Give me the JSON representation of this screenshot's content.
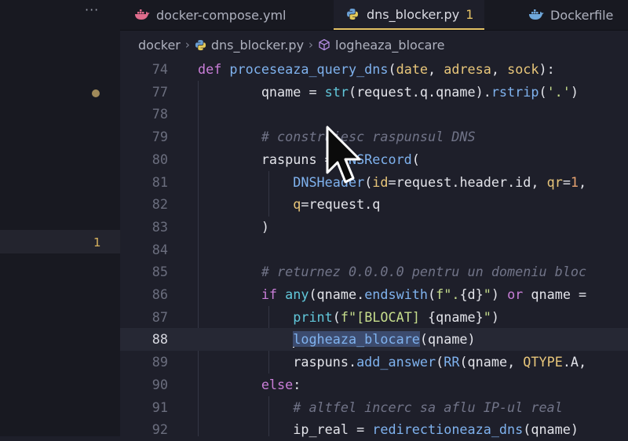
{
  "activity": {
    "more_label": "···",
    "badge_count": "1"
  },
  "tabs": [
    {
      "label": "docker-compose.yml",
      "icon": "docker-icon",
      "badge": ""
    },
    {
      "label": "dns_blocker.py",
      "icon": "python-icon",
      "badge": "1"
    },
    {
      "label": "Dockerfile",
      "icon": "docker-icon",
      "badge": ""
    }
  ],
  "breadcrumbs": [
    "docker",
    "dns_blocker.py",
    "logheaza_blocare"
  ],
  "colors": {
    "accent": "#e4c265",
    "keyword": "#c97ed8",
    "function": "#7fb2ee",
    "string": "#c6dd8c",
    "comment": "#717488"
  },
  "lines": [
    {
      "num": "74",
      "tokens": [
        {
          "t": "def ",
          "c": "kw"
        },
        {
          "t": "proceseaza_query_dns",
          "c": "fn"
        },
        {
          "t": "("
        },
        {
          "t": "date",
          "c": "pm"
        },
        {
          "t": ", "
        },
        {
          "t": "adresa",
          "c": "pm"
        },
        {
          "t": ", "
        },
        {
          "t": "sock",
          "c": "pm"
        },
        {
          "t": "):"
        }
      ]
    },
    {
      "num": "77",
      "tokens": [
        {
          "t": "        qname = "
        },
        {
          "t": "str",
          "c": "bi"
        },
        {
          "t": "(request.q.qname)."
        },
        {
          "t": "rstrip",
          "c": "fn"
        },
        {
          "t": "("
        },
        {
          "t": "'.'",
          "c": "str"
        },
        {
          "t": ")"
        }
      ]
    },
    {
      "num": "78",
      "tokens": []
    },
    {
      "num": "79",
      "tokens": [
        {
          "t": "        "
        },
        {
          "t": "# construiesc raspunsul DNS",
          "c": "cm"
        }
      ]
    },
    {
      "num": "80",
      "tokens": [
        {
          "t": "        raspuns = "
        },
        {
          "t": "DNSRecord",
          "c": "fn"
        },
        {
          "t": "("
        }
      ]
    },
    {
      "num": "81",
      "tokens": [
        {
          "t": "            "
        },
        {
          "t": "DNSHeader",
          "c": "fn"
        },
        {
          "t": "("
        },
        {
          "t": "id",
          "c": "pm"
        },
        {
          "t": "=request.header.id, "
        },
        {
          "t": "qr",
          "c": "pm"
        },
        {
          "t": "="
        },
        {
          "t": "1",
          "c": "num"
        },
        {
          "t": ","
        }
      ]
    },
    {
      "num": "82",
      "tokens": [
        {
          "t": "            "
        },
        {
          "t": "q",
          "c": "pm"
        },
        {
          "t": "=request.q"
        }
      ]
    },
    {
      "num": "83",
      "tokens": [
        {
          "t": "        )"
        }
      ]
    },
    {
      "num": "84",
      "tokens": []
    },
    {
      "num": "85",
      "tokens": [
        {
          "t": "        "
        },
        {
          "t": "# returnez 0.0.0.0 pentru un domeniu bloc",
          "c": "cm"
        }
      ]
    },
    {
      "num": "86",
      "tokens": [
        {
          "t": "        "
        },
        {
          "t": "if ",
          "c": "kw"
        },
        {
          "t": "any",
          "c": "bi"
        },
        {
          "t": "(qname."
        },
        {
          "t": "endswith",
          "c": "fn"
        },
        {
          "t": "("
        },
        {
          "t": "f\".",
          "c": "str"
        },
        {
          "t": "{d}"
        },
        {
          "t": "\"",
          "c": "str"
        },
        {
          "t": ") "
        },
        {
          "t": "or",
          "c": "kw"
        },
        {
          "t": " qname ="
        }
      ]
    },
    {
      "num": "87",
      "tokens": [
        {
          "t": "            "
        },
        {
          "t": "print",
          "c": "bi"
        },
        {
          "t": "("
        },
        {
          "t": "f\"[BLOCAT] ",
          "c": "str"
        },
        {
          "t": "{qname}"
        },
        {
          "t": "\"",
          "c": "str"
        },
        {
          "t": ")"
        }
      ]
    },
    {
      "num": "88",
      "current": true,
      "tokens": [
        {
          "t": "            "
        },
        {
          "t": "|",
          "c": "caret"
        },
        {
          "t": "logheaza_blocare",
          "c": "fn sel"
        },
        {
          "t": "(qname)"
        }
      ]
    },
    {
      "num": "89",
      "tokens": [
        {
          "t": "            raspuns."
        },
        {
          "t": "add_answer",
          "c": "fn"
        },
        {
          "t": "("
        },
        {
          "t": "RR",
          "c": "fn"
        },
        {
          "t": "(qname, "
        },
        {
          "t": "QTYPE",
          "c": "attr"
        },
        {
          "t": ".A,"
        }
      ]
    },
    {
      "num": "90",
      "tokens": [
        {
          "t": "        "
        },
        {
          "t": "else",
          "c": "kw"
        },
        {
          "t": ":"
        }
      ]
    },
    {
      "num": "91",
      "tokens": [
        {
          "t": "            "
        },
        {
          "t": "# altfel incerc sa aflu IP-ul real",
          "c": "cm"
        }
      ]
    },
    {
      "num": "92",
      "tokens": [
        {
          "t": "            ip_real = "
        },
        {
          "t": "redirectioneaza_dns",
          "c": "fn"
        },
        {
          "t": "(qname)"
        }
      ]
    }
  ]
}
